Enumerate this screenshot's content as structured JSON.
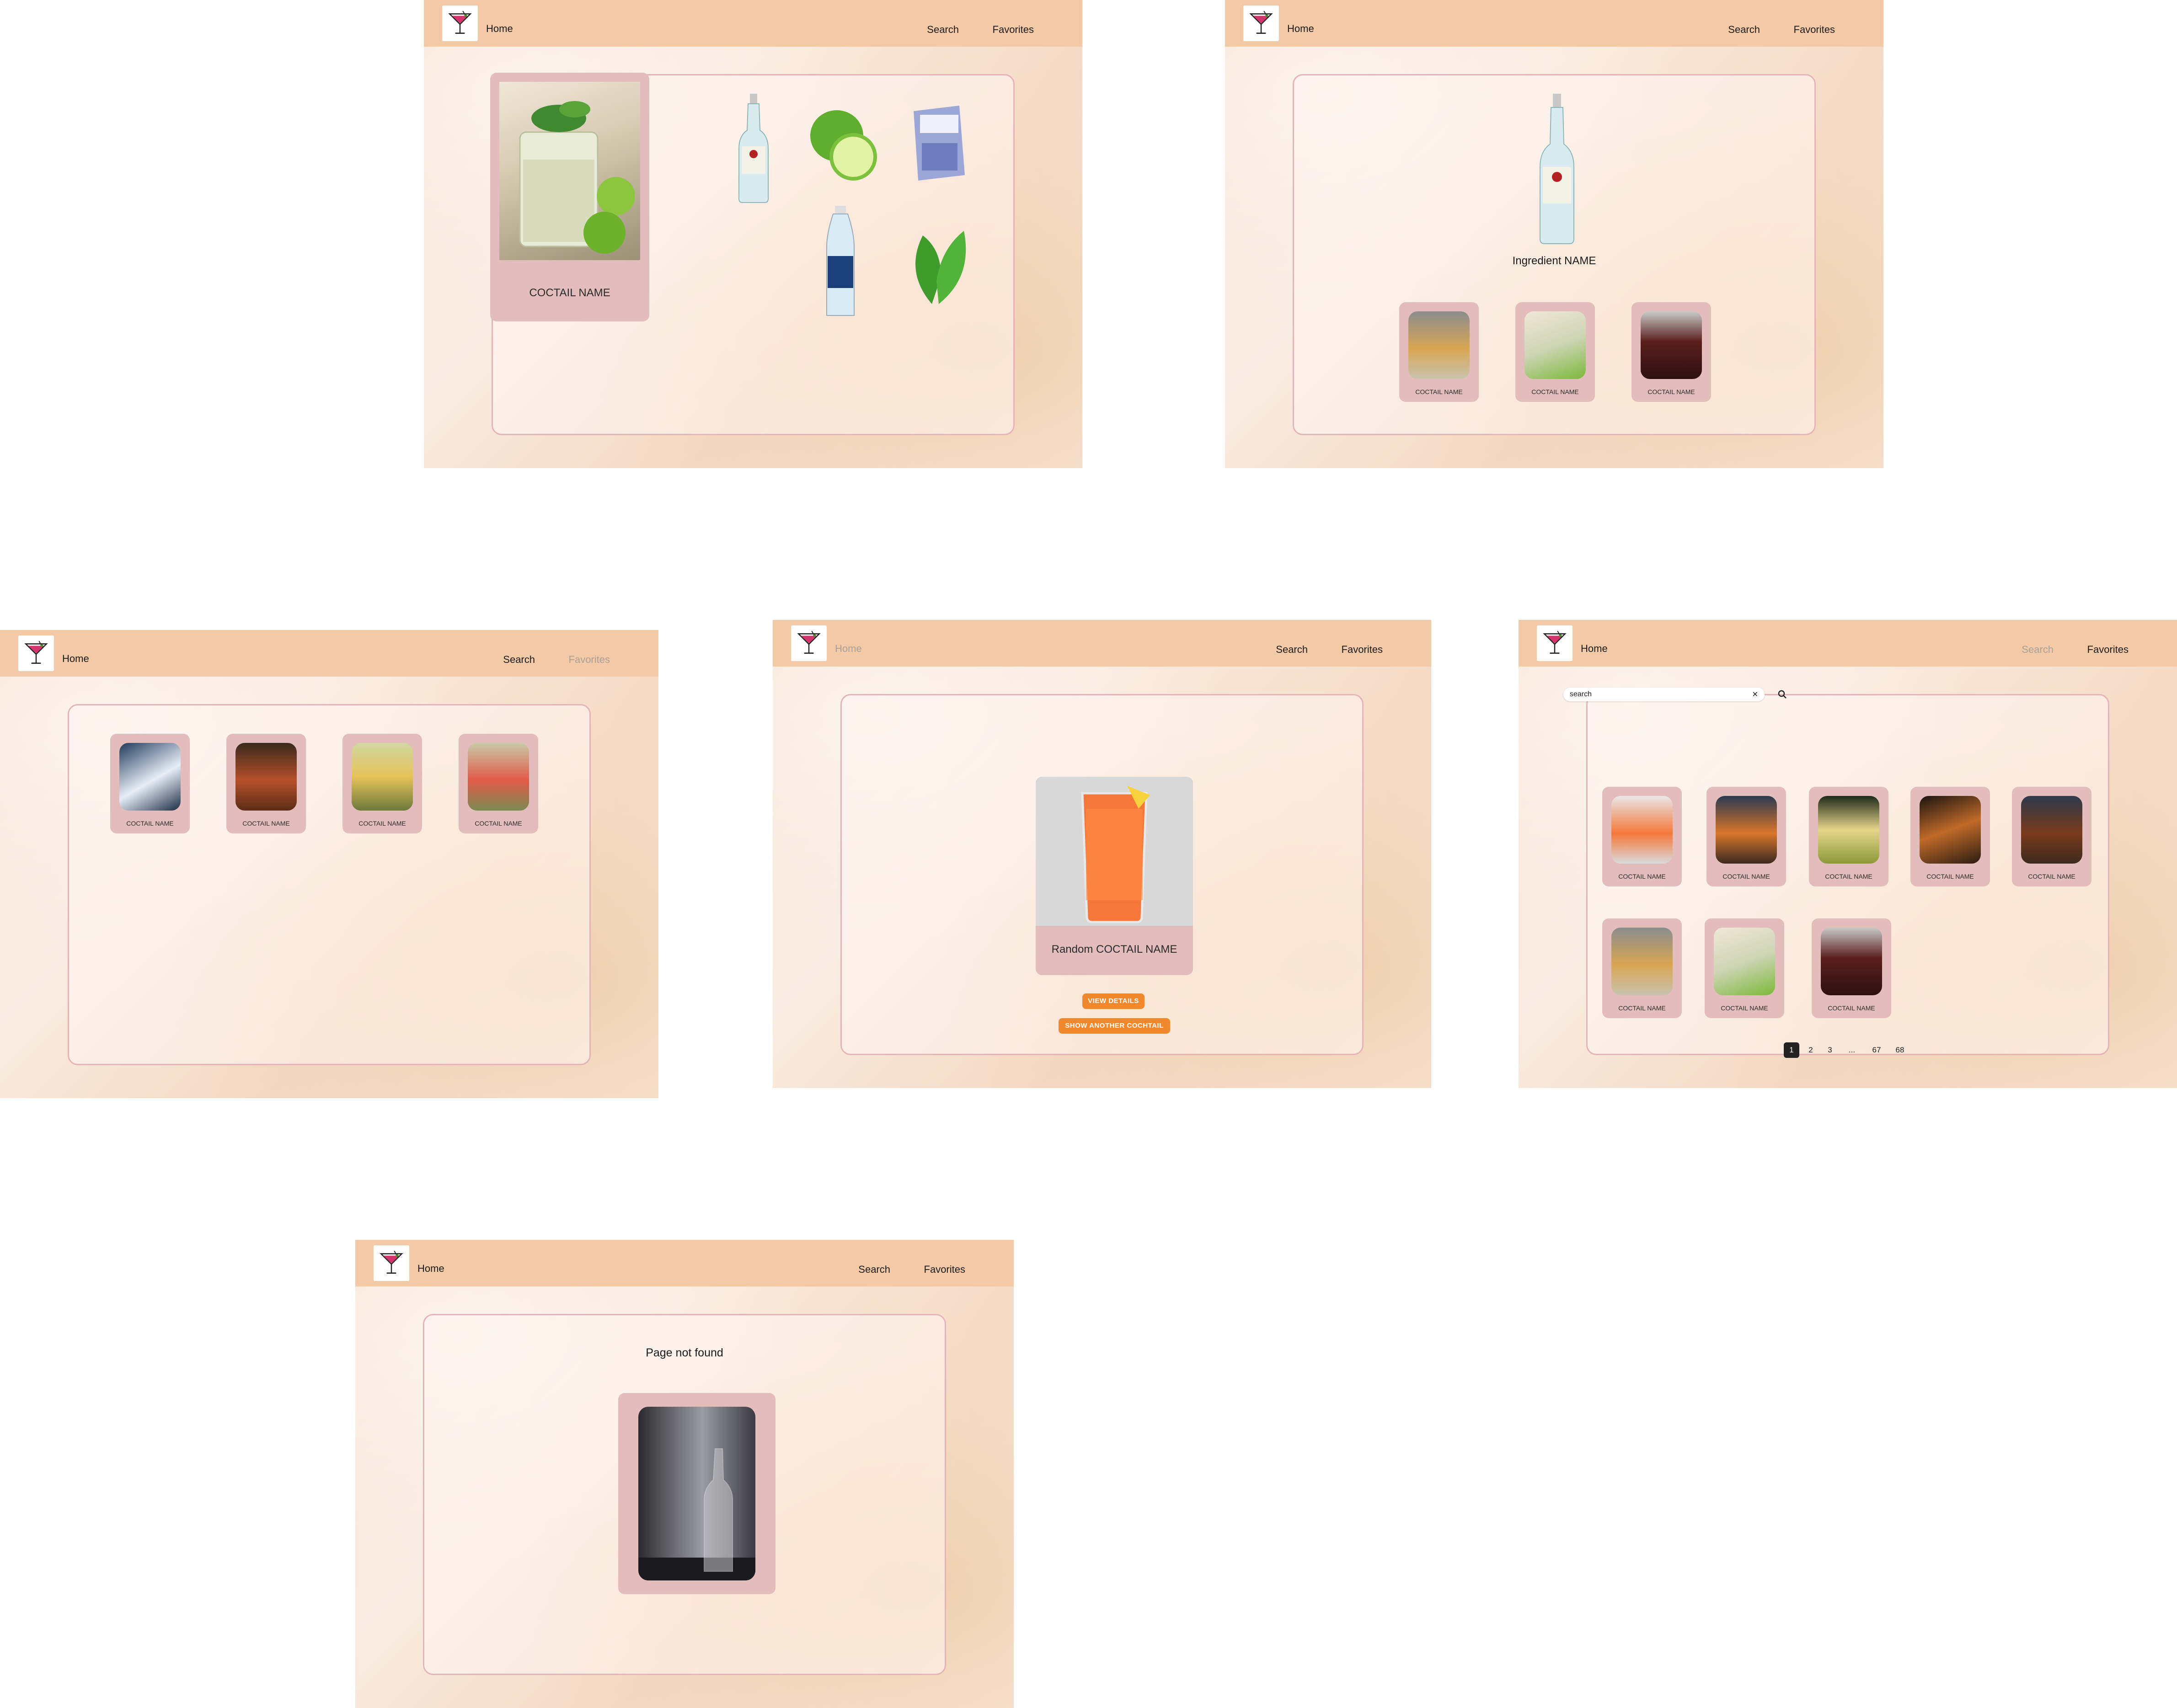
{
  "nav": {
    "home": "Home",
    "search": "Search",
    "favorites": "Favorites"
  },
  "cocktail_detail": {
    "cocktail_name": "COCTAIL NAME"
  },
  "ingredient_page": {
    "ingredient_name": "Ingredient NAME",
    "cards": [
      "COCTAIL NAME",
      "COCTAIL NAME",
      "COCTAIL NAME"
    ]
  },
  "favorites_page": {
    "cards": [
      "COCTAIL NAME",
      "COCTAIL NAME",
      "COCTAIL NAME",
      "COCTAIL NAME"
    ]
  },
  "random_page": {
    "cocktail_name": "Random COCTAIL NAME",
    "view_details": "VIEW DETAILS",
    "show_another": "SHOW ANOTHER COCHTAIL"
  },
  "search_page": {
    "search_value": "search",
    "clear_glyph": "✕",
    "cards_row1": [
      "COCTAIL NAME",
      "COCTAIL NAME",
      "COCTAIL NAME",
      "COCTAIL NAME",
      "COCTAIL NAME"
    ],
    "cards_row2": [
      "COCTAIL NAME",
      "COCTAIL NAME",
      "COCTAIL NAME"
    ],
    "pagination": [
      "1",
      "2",
      "3",
      "...",
      "67",
      "68"
    ]
  },
  "not_found_page": {
    "message": "Page not found"
  },
  "colors": {
    "navbar": "#f3caa5",
    "card": "#e3bdbb",
    "panel_border": "#e6b4b8",
    "accent": "#f0882e"
  },
  "icons": [
    "cocktail-logo-icon",
    "search-icon",
    "close-icon"
  ]
}
